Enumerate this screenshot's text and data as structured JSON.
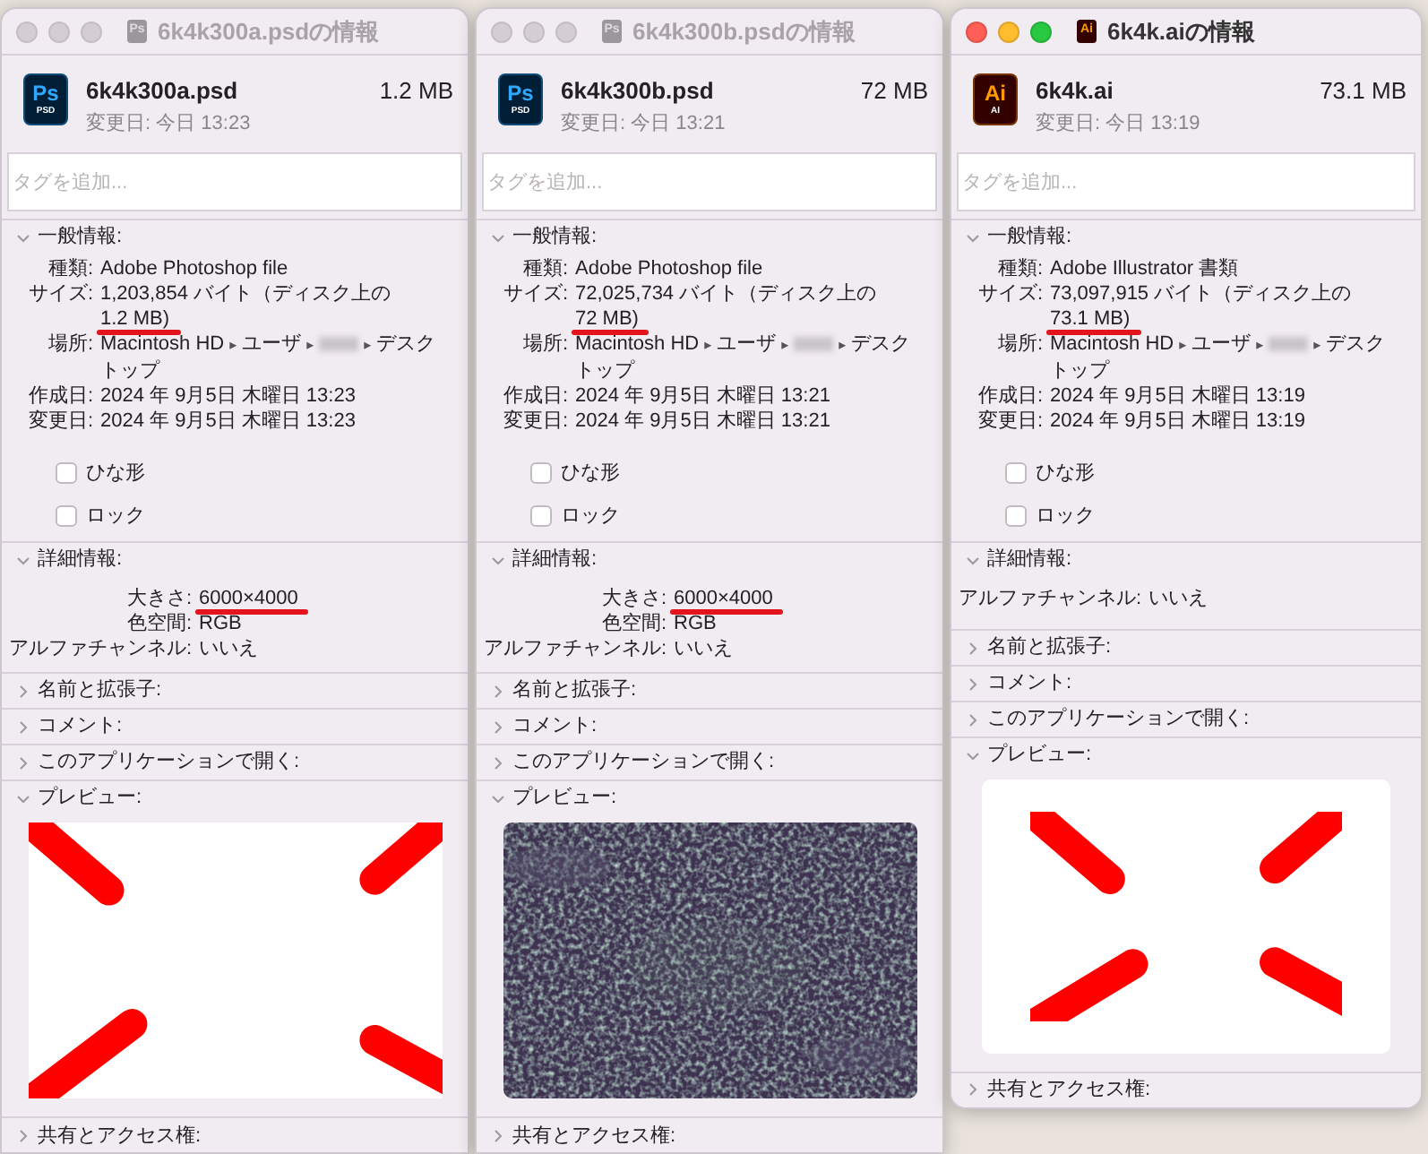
{
  "windows": [
    {
      "active": false,
      "title": "6k4k300a.psdの情報",
      "title_icon": {
        "kind": "psd",
        "label": "Ps"
      },
      "icon": {
        "kind": "psd",
        "label": "Ps",
        "caption": "PSD"
      },
      "name": "6k4k300a.psd",
      "size": "1.2 MB",
      "modified": "変更日: 今日 13:23",
      "tags": {
        "placeholder": "タグを追加..."
      },
      "sections": [
        {
          "kind": "info",
          "title": "一般情報:",
          "expanded": true,
          "rows": [
            {
              "kind": "text",
              "label": "種類:",
              "lines": [
                "Adobe Photoshop file"
              ],
              "underlined": false
            },
            {
              "kind": "text",
              "label": "サイズ:",
              "lines": [
                "1,203,854 バイト（ディスク上の",
                "1.2 MB)"
              ],
              "underlined": true
            },
            {
              "kind": "path",
              "label": "場所:",
              "separator": "▸",
              "segments": [
                {
                  "text": "Macintosh HD"
                },
                {
                  "text": "ユーザ"
                },
                {
                  "kind": "redacted"
                },
                {
                  "text": "デスク"
                }
              ],
              "continuation": "トップ"
            },
            {
              "kind": "text",
              "label": "作成日:",
              "lines": [
                "2024 年 9月5日 木曜日 13:23"
              ],
              "underlined": false
            },
            {
              "kind": "text",
              "label": "変更日:",
              "lines": [
                "2024 年 9月5日 木曜日 13:23"
              ],
              "underlined": false
            }
          ],
          "checkboxes": [
            {
              "label": "ひな形",
              "checked": false
            },
            {
              "label": "ロック",
              "checked": false
            }
          ]
        },
        {
          "kind": "details",
          "title": "詳細情報:",
          "expanded": true,
          "rows": [
            {
              "kind": "text",
              "label": "大きさ:",
              "lines": [
                "6000×4000"
              ],
              "underlined": true
            },
            {
              "kind": "text",
              "label": "色空間:",
              "lines": [
                "RGB"
              ],
              "underlined": false
            },
            {
              "kind": "text",
              "label": "アルファチャンネル:",
              "lines": [
                "いいえ"
              ],
              "underlined": false
            }
          ]
        },
        {
          "kind": "plain",
          "title": "名前と拡張子:",
          "expanded": false
        },
        {
          "kind": "plain",
          "title": "コメント:",
          "expanded": false
        },
        {
          "kind": "plain",
          "title": "このアプリケーションで開く:",
          "expanded": false
        },
        {
          "kind": "preview",
          "title": "プレビュー:",
          "expanded": true,
          "preview": {
            "kind": "drawing",
            "framed": false
          }
        },
        {
          "kind": "plain",
          "title": "共有とアクセス権:",
          "expanded": false
        }
      ]
    },
    {
      "active": false,
      "title": "6k4k300b.psdの情報",
      "title_icon": {
        "kind": "psd",
        "label": "Ps"
      },
      "icon": {
        "kind": "psd",
        "label": "Ps",
        "caption": "PSD"
      },
      "name": "6k4k300b.psd",
      "size": "72 MB",
      "modified": "変更日: 今日 13:21",
      "tags": {
        "placeholder": "タグを追加..."
      },
      "sections": [
        {
          "kind": "info",
          "title": "一般情報:",
          "expanded": true,
          "rows": [
            {
              "kind": "text",
              "label": "種類:",
              "lines": [
                "Adobe Photoshop file"
              ],
              "underlined": false
            },
            {
              "kind": "text",
              "label": "サイズ:",
              "lines": [
                "72,025,734 バイト（ディスク上の",
                "72 MB)"
              ],
              "underlined": true
            },
            {
              "kind": "path",
              "label": "場所:",
              "separator": "▸",
              "segments": [
                {
                  "text": "Macintosh HD"
                },
                {
                  "text": "ユーザ"
                },
                {
                  "kind": "redacted"
                },
                {
                  "text": "デスク"
                }
              ],
              "continuation": "トップ"
            },
            {
              "kind": "text",
              "label": "作成日:",
              "lines": [
                "2024 年 9月5日 木曜日 13:21"
              ],
              "underlined": false
            },
            {
              "kind": "text",
              "label": "変更日:",
              "lines": [
                "2024 年 9月5日 木曜日 13:21"
              ],
              "underlined": false
            }
          ],
          "checkboxes": [
            {
              "label": "ひな形",
              "checked": false
            },
            {
              "label": "ロック",
              "checked": false
            }
          ]
        },
        {
          "kind": "details",
          "title": "詳細情報:",
          "expanded": true,
          "rows": [
            {
              "kind": "text",
              "label": "大きさ:",
              "lines": [
                "6000×4000"
              ],
              "underlined": true
            },
            {
              "kind": "text",
              "label": "色空間:",
              "lines": [
                "RGB"
              ],
              "underlined": false
            },
            {
              "kind": "text",
              "label": "アルファチャンネル:",
              "lines": [
                "いいえ"
              ],
              "underlined": false
            }
          ]
        },
        {
          "kind": "plain",
          "title": "名前と拡張子:",
          "expanded": false
        },
        {
          "kind": "plain",
          "title": "コメント:",
          "expanded": false
        },
        {
          "kind": "plain",
          "title": "このアプリケーションで開く:",
          "expanded": false
        },
        {
          "kind": "preview",
          "title": "プレビュー:",
          "expanded": true
        },
        {
          "kind": "plain",
          "title": "共有とアクセス権:",
          "expanded": false
        }
      ]
    },
    {
      "active": true,
      "title": "6k4k.aiの情報",
      "title_icon": {
        "kind": "ai",
        "label": "Ai"
      },
      "icon": {
        "kind": "ai",
        "label": "Ai",
        "caption": "AI"
      },
      "name": "6k4k.ai",
      "size": "73.1 MB",
      "modified": "変更日: 今日 13:19",
      "tags": {
        "placeholder": "タグを追加..."
      },
      "sections": [
        {
          "kind": "info",
          "title": "一般情報:",
          "expanded": true,
          "rows": [
            {
              "kind": "text",
              "label": "種類:",
              "lines": [
                "Adobe Illustrator 書類"
              ],
              "underlined": false
            },
            {
              "kind": "text",
              "label": "サイズ:",
              "lines": [
                "73,097,915 バイト（ディスク上の",
                "73.1 MB)"
              ],
              "underlined": true
            },
            {
              "kind": "path",
              "label": "場所:",
              "separator": "▸",
              "segments": [
                {
                  "text": "Macintosh HD"
                },
                {
                  "text": "ユーザ"
                },
                {
                  "kind": "redacted"
                },
                {
                  "text": "デスク"
                }
              ],
              "continuation": "トップ"
            },
            {
              "kind": "text",
              "label": "作成日:",
              "lines": [
                "2024 年 9月5日 木曜日 13:19"
              ],
              "underlined": false
            },
            {
              "kind": "text",
              "label": "変更日:",
              "lines": [
                "2024 年 9月5日 木曜日 13:19"
              ],
              "underlined": false
            }
          ],
          "checkboxes": [
            {
              "label": "ひな形",
              "checked": false
            },
            {
              "label": "ロック",
              "checked": false
            }
          ]
        },
        {
          "kind": "details",
          "title": "詳細情報:",
          "expanded": true,
          "rows": [
            {
              "kind": "text",
              "label": "アルファチャンネル:",
              "lines": [
                "いいえ"
              ],
              "underlined": false
            }
          ]
        },
        {
          "kind": "plain",
          "title": "名前と拡張子:",
          "expanded": false
        },
        {
          "kind": "plain",
          "title": "コメント:",
          "expanded": false
        },
        {
          "kind": "plain",
          "title": "このアプリケーションで開く:",
          "expanded": false
        },
        {
          "kind": "preview",
          "title": "プレビュー:",
          "expanded": true,
          "preview": {
            "kind": "drawing",
            "framed": true
          }
        },
        {
          "kind": "plain",
          "title": "共有とアクセス権:",
          "expanded": false
        }
      ]
    }
  ]
}
